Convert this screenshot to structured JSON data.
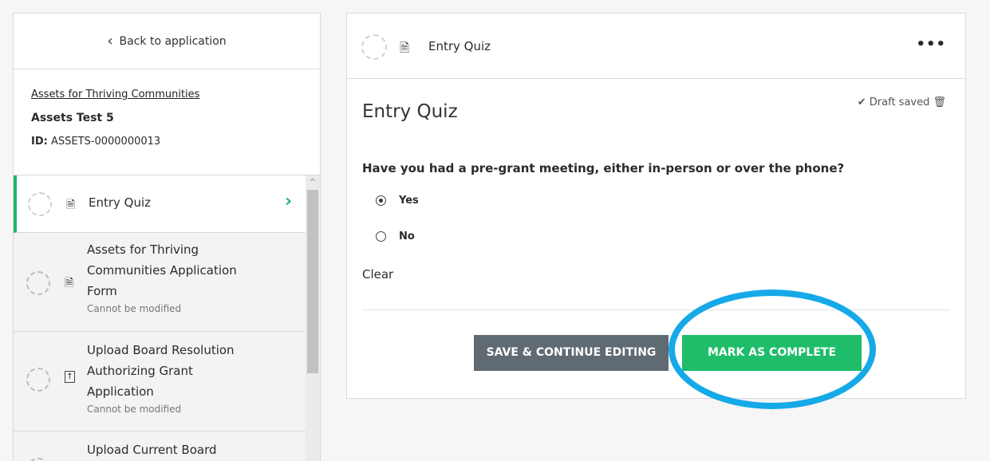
{
  "sidebar": {
    "back_label": "Back to application",
    "program": "Assets for Thriving Communities",
    "app_name": "Assets Test 5",
    "id_label": "ID:",
    "id_value": "ASSETS-0000000013",
    "items": [
      {
        "label": "Entry Quiz",
        "note": ""
      },
      {
        "label": "Assets for Thriving Communities Application Form",
        "note": "Cannot be modified"
      },
      {
        "label": "Upload Board Resolution Authorizing Grant Application",
        "note": "Cannot be modified"
      },
      {
        "label": "Upload Current Board",
        "note": ""
      }
    ]
  },
  "main": {
    "header_title": "Entry Quiz",
    "more": "•••",
    "title": "Entry Quiz",
    "draft_status": "✔ Draft saved 🗑",
    "question": "Have you had a pre-grant meeting, either in-person or over the phone?",
    "options": [
      {
        "label": "Yes",
        "selected": true
      },
      {
        "label": "No",
        "selected": false
      }
    ],
    "clear_label": "Clear",
    "save_button": "SAVE & CONTINUE EDITING",
    "complete_button": "MARK AS COMPLETE"
  },
  "colors": {
    "accent_green": "#1fbd6a",
    "save_grey": "#5f6a72",
    "highlight_blue": "#15a9e8"
  }
}
